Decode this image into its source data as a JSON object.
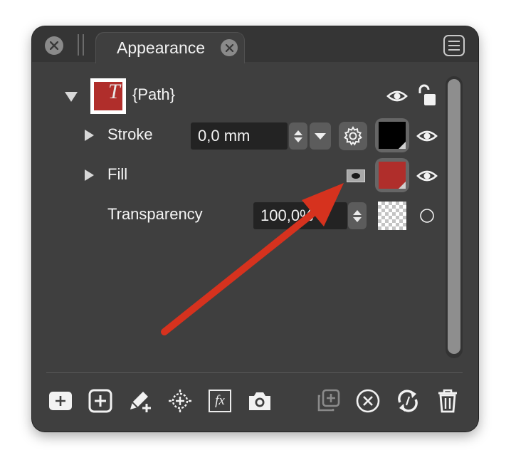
{
  "panel": {
    "tab_title": "Appearance"
  },
  "layers": {
    "path": {
      "label": "{Path}",
      "thumbnail_glyph": "T",
      "fill_color": "#b02e2b"
    },
    "stroke": {
      "label": "Stroke",
      "width_value": "0,0 mm",
      "swatch_color": "#000000"
    },
    "fill": {
      "label": "Fill",
      "swatch_color": "#b02e2b"
    },
    "transparency": {
      "label": "Transparency",
      "value": "100,0%"
    }
  },
  "toolbar": {
    "fx_label": "fx"
  },
  "colors": {
    "panel_bg": "#3f3f3f",
    "annotation_arrow": "#d6321e"
  },
  "icons": [
    "close-icon",
    "menu-icon",
    "eye-icon",
    "unlock-icon",
    "gear-icon",
    "add-icon",
    "add-layer-icon",
    "brush-plus-icon",
    "target-icon",
    "fx-icon",
    "camera-icon",
    "duplicate-icon",
    "delete-circle-icon",
    "sync-icon",
    "trash-icon"
  ]
}
